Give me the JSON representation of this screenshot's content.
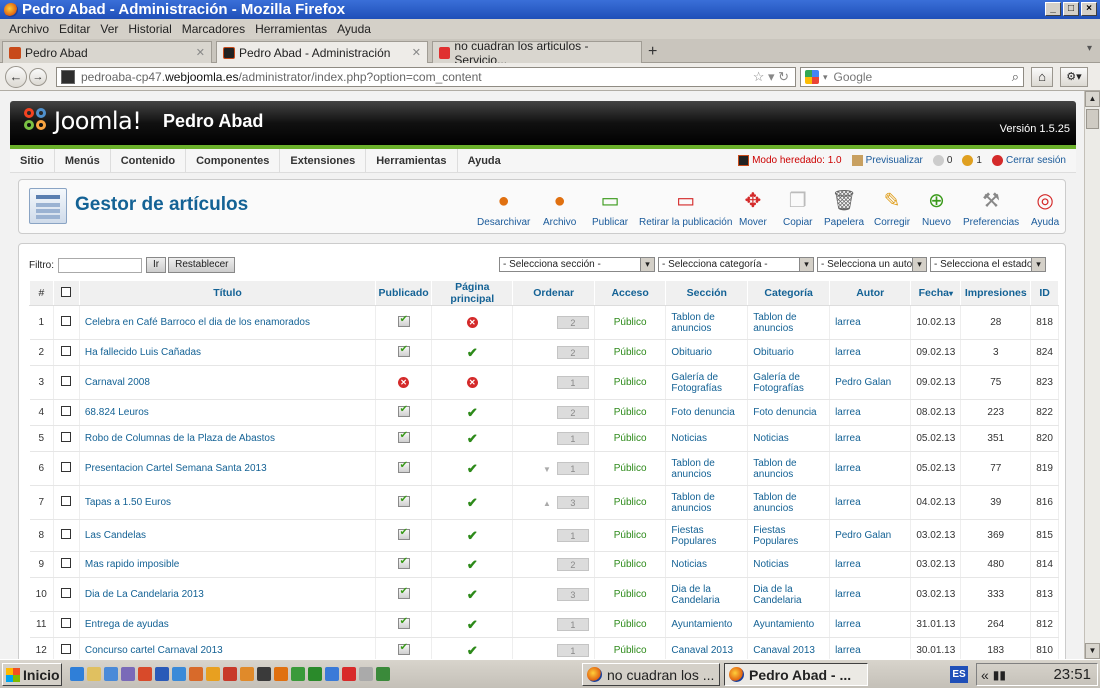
{
  "window": {
    "title": "Pedro Abad - Administración - Mozilla Firefox"
  },
  "menubar": [
    "Archivo",
    "Editar",
    "Ver",
    "Historial",
    "Marcadores",
    "Herramientas",
    "Ayuda"
  ],
  "tabs": [
    {
      "label": "Pedro Abad",
      "active": false
    },
    {
      "label": "Pedro Abad - Administración",
      "active": true
    },
    {
      "label": "no cuadran los articulos - Servicio...",
      "active": false
    }
  ],
  "address": {
    "prefix": "pedroaba-cp47.",
    "domain": "webjoomla.es",
    "path": "/administrator/index.php?option=com_content"
  },
  "search": {
    "placeholder": "Google"
  },
  "joomla": {
    "logo_text": "Joomla!",
    "site_name": "Pedro Abad",
    "version": "Versión 1.5.25"
  },
  "admin_menu": [
    "Sitio",
    "Menús",
    "Contenido",
    "Componentes",
    "Extensiones",
    "Herramientas",
    "Ayuda"
  ],
  "status": {
    "legacy": "Modo heredado: 1.0",
    "preview": "Previsualizar",
    "messages": "0",
    "users": "1",
    "logout": "Cerrar sesión"
  },
  "page_title": "Gestor de artículos",
  "toolbar": [
    "Desarchivar",
    "Archivo",
    "Publicar",
    "Retirar la publicación",
    "Mover",
    "Copiar",
    "Papelera",
    "Corregir",
    "Nuevo",
    "Preferencias",
    "Ayuda"
  ],
  "filter": {
    "label": "Filtro:",
    "value": "",
    "go": "Ir",
    "reset": "Restablecer",
    "section": "- Selecciona sección -",
    "category": "- Selecciona categoría -",
    "author": "- Selecciona un autor -",
    "state": "- Selecciona el estado -"
  },
  "columns": [
    "#",
    "",
    "Título",
    "Publicado",
    "Página principal",
    "Ordenar",
    "Acceso",
    "Sección",
    "Categoría",
    "Autor",
    "Fecha",
    "Impresiones",
    "ID"
  ],
  "articles": [
    {
      "n": "1",
      "title": "Celebra en Café Barroco el dia de los enamorados",
      "published": true,
      "front": false,
      "order": "2",
      "access": "Público",
      "section": "Tablon de anuncios",
      "category": "Tablon de anuncios",
      "author": "larrea",
      "date": "10.02.13",
      "hits": "28",
      "id": "818"
    },
    {
      "n": "2",
      "title": "Ha fallecido Luis Cañadas",
      "published": true,
      "front": true,
      "order": "2",
      "access": "Público",
      "section": "Obituario",
      "category": "Obituario",
      "author": "larrea",
      "date": "09.02.13",
      "hits": "3",
      "id": "824"
    },
    {
      "n": "3",
      "title": "Carnaval 2008",
      "published": false,
      "front": false,
      "order": "1",
      "access": "Público",
      "section": "Galería de Fotografías",
      "category": "Galería de Fotografías",
      "author": "Pedro Galan",
      "date": "09.02.13",
      "hits": "75",
      "id": "823"
    },
    {
      "n": "4",
      "title": "68.824 Leuros",
      "published": true,
      "front": true,
      "order": "2",
      "access": "Público",
      "section": "Foto denuncia",
      "category": "Foto denuncia",
      "author": "larrea",
      "date": "08.02.13",
      "hits": "223",
      "id": "822"
    },
    {
      "n": "5",
      "title": "Robo de Columnas de la Plaza de Abastos",
      "published": true,
      "front": true,
      "order": "1",
      "access": "Público",
      "section": "Noticias",
      "category": "Noticias",
      "author": "larrea",
      "date": "05.02.13",
      "hits": "351",
      "id": "820"
    },
    {
      "n": "6",
      "title": "Presentacion Cartel Semana Santa 2013",
      "published": true,
      "front": true,
      "order": "1",
      "access": "Público",
      "section": "Tablon de anuncios",
      "category": "Tablon de anuncios",
      "author": "larrea",
      "date": "05.02.13",
      "hits": "77",
      "id": "819"
    },
    {
      "n": "7",
      "title": "Tapas a 1.50 Euros",
      "published": true,
      "front": true,
      "order": "3",
      "access": "Público",
      "section": "Tablon de anuncios",
      "category": "Tablon de anuncios",
      "author": "larrea",
      "date": "04.02.13",
      "hits": "39",
      "id": "816"
    },
    {
      "n": "8",
      "title": "Las Candelas",
      "published": true,
      "front": true,
      "order": "1",
      "access": "Público",
      "section": "Fiestas Populares",
      "category": "Fiestas Populares",
      "author": "Pedro Galan",
      "date": "03.02.13",
      "hits": "369",
      "id": "815"
    },
    {
      "n": "9",
      "title": "Mas rapido imposible",
      "published": true,
      "front": true,
      "order": "2",
      "access": "Público",
      "section": "Noticias",
      "category": "Noticias",
      "author": "larrea",
      "date": "03.02.13",
      "hits": "480",
      "id": "814"
    },
    {
      "n": "10",
      "title": "Dia de La Candelaria 2013",
      "published": true,
      "front": true,
      "order": "3",
      "access": "Público",
      "section": "Dia de la Candelaria",
      "category": "Dia de la Candelaria",
      "author": "larrea",
      "date": "03.02.13",
      "hits": "333",
      "id": "813"
    },
    {
      "n": "11",
      "title": "Entrega de ayudas",
      "published": true,
      "front": true,
      "order": "1",
      "access": "Público",
      "section": "Ayuntamiento",
      "category": "Ayuntamiento",
      "author": "larrea",
      "date": "31.01.13",
      "hits": "264",
      "id": "812"
    },
    {
      "n": "12",
      "title": "Concurso cartel Carnaval 2013",
      "published": true,
      "front": true,
      "order": "1",
      "access": "Público",
      "section": "Canaval 2013",
      "category": "Canaval 2013",
      "author": "larrea",
      "date": "30.01.13",
      "hits": "183",
      "id": "810"
    }
  ],
  "taskbar": {
    "start": "Inicio",
    "windows": [
      {
        "label": "no cuadran los ...",
        "active": false
      },
      {
        "label": "Pedro Abad - ...",
        "active": true
      }
    ],
    "lang": "ES",
    "clock": "23:51"
  }
}
